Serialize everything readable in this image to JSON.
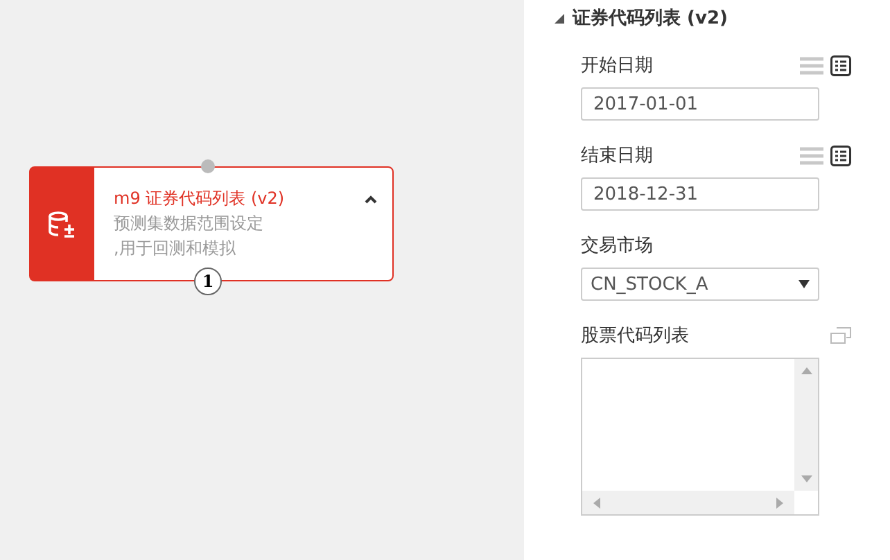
{
  "node": {
    "id": "m9",
    "title": "证券代码列表 (v2)",
    "description": [
      "预测集数据范围设定",
      ",用于回测和模拟"
    ],
    "port_label": "1"
  },
  "panel": {
    "title": "证券代码列表 (v2)",
    "fields": [
      {
        "kind": "date",
        "label": "开始日期",
        "value": "2017-01-01"
      },
      {
        "kind": "date",
        "label": "结束日期",
        "value": "2018-12-31"
      },
      {
        "kind": "select",
        "label": "交易市场",
        "value": "CN_STOCK_A"
      },
      {
        "kind": "textarea",
        "label": "股票代码列表"
      }
    ]
  }
}
